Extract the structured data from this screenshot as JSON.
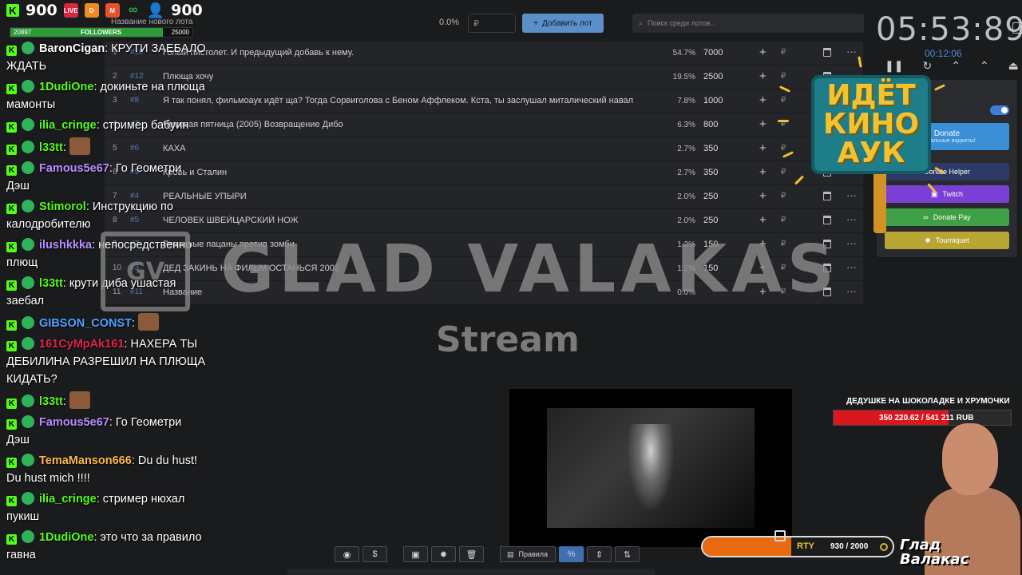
{
  "stats": {
    "kick_count": "900",
    "viewer_count": "900",
    "followers_label": "FOLLOWERS",
    "followers_current": "20897",
    "followers_goal": "25000",
    "followers_fraction": 0.836,
    "badges": [
      {
        "name": "live-badge-icon",
        "label": "LIVE",
        "color": "#d7263d"
      },
      {
        "name": "donationalerts-icon",
        "label": "D",
        "color": "#f08a24"
      },
      {
        "name": "m-badge-icon",
        "label": "M",
        "color": "#e8512c"
      },
      {
        "name": "infinity-icon",
        "label": "∞",
        "color": "#2fa84f"
      }
    ]
  },
  "auction": {
    "new_lot_placeholder": "Название нового лота",
    "total_percent": "0.0%",
    "amount_placeholder": "₽",
    "add_lot_label": "Добавить лот",
    "search_placeholder": "Поиск среди лотов...",
    "currency": "₽",
    "rows": [
      {
        "rank": "1",
        "num": "#10",
        "title": "Голый пистолет. И предыдущий добавь к нему.",
        "pct": "54.7%",
        "amount": "7000"
      },
      {
        "rank": "2",
        "num": "#12",
        "title": "Плющa хочу",
        "pct": "19.5%",
        "amount": "2500"
      },
      {
        "rank": "3",
        "num": "#8",
        "title": "Я так понял, фильмоаук идёт ща? Тогда Сорвиголова с Беном Аффлеком. Кста, ты заслушал миталический навал",
        "pct": "7.8%",
        "amount": "1000"
      },
      {
        "rank": "4",
        "num": "#2",
        "title": "Чумовая пятница (2005) Возвращение Дибо",
        "pct": "6.3%",
        "amount": "800"
      },
      {
        "rank": "5",
        "num": "#6",
        "title": "КАХА",
        "pct": "2.7%",
        "amount": "350"
      },
      {
        "rank": "6",
        "num": "#9",
        "title": "Кровь и Сталин",
        "pct": "2.7%",
        "amount": "350"
      },
      {
        "rank": "7",
        "num": "#4",
        "title": "РЕАЛЬНЫЕ УПЫРИ",
        "pct": "2.0%",
        "amount": "250"
      },
      {
        "rank": "8",
        "num": "#5",
        "title": "ЧЕЛОВЕК ШВЕЙЦАРСКИЙ НОЖ",
        "pct": "2.0%",
        "amount": "250"
      },
      {
        "rank": "9",
        "num": "#7",
        "title": "Реальные пацаны против зомби",
        "pct": "1.2%",
        "amount": "150"
      },
      {
        "rank": "10",
        "num": "#3",
        "title": "ДЕД ЗАКИНЬ НА ФИЛЬМ ОСТАНЬСЯ 2005",
        "pct": "1.2%",
        "amount": "150"
      },
      {
        "rank": "11",
        "num": "#11",
        "title": "Название",
        "pct": "0.0%",
        "amount": ""
      }
    ]
  },
  "chat": [
    {
      "user": "BaronCigan",
      "color": "#ffffff",
      "text": "КРУТИ ЗАЕБАЛО ЖДАТЬ"
    },
    {
      "user": "1DudiOne",
      "color": "#53fc18",
      "text": "докиньте на плющa мамонты"
    },
    {
      "user": "ilia_cringe",
      "color": "#53fc18",
      "text": "стример бабуин"
    },
    {
      "user": "l33tt",
      "color": "#53fc18",
      "text": ""
    },
    {
      "user": "Famous5e67",
      "color": "#b98cff",
      "text": "Го Геометри Дэш"
    },
    {
      "user": "Stimorol",
      "color": "#53fc18",
      "text": "Инструкцию по калодробителю"
    },
    {
      "user": "ilushkkka",
      "color": "#b98cff",
      "text": "непосредственно плющ"
    },
    {
      "user": "l33tt",
      "color": "#53fc18",
      "text": "крути диба ушастая заебал"
    },
    {
      "user": "GIBSON_CONST",
      "color": "#4da3ff",
      "text": ""
    },
    {
      "user": "161CyMpAk161",
      "color": "#e0234a",
      "text": "НАХЕРА ТЫ ДЕБИЛИНА РАЗРЕШИЛ НА ПЛЮЩА КИДАТЬ?"
    },
    {
      "user": "l33tt",
      "color": "#53fc18",
      "text": ""
    },
    {
      "user": "Famous5e67",
      "color": "#b98cff",
      "text": "Го Геометри Дэш"
    },
    {
      "user": "TemaManson666",
      "color": "#ffb84d",
      "text": "Du du hust! Du hust mich !!!!"
    },
    {
      "user": "ilia_cringe",
      "color": "#53fc18",
      "text": "стример нюхал пукиш"
    },
    {
      "user": "1DudiOne",
      "color": "#53fc18",
      "text": "это что за правило гавна"
    }
  ],
  "watermark": {
    "logo": "GV",
    "title": "GLAD VALAKAS",
    "subtitle": "Stream"
  },
  "timer": {
    "main": "05:53:89",
    "sub": "00:12:06"
  },
  "right_panel": {
    "buttons": [
      {
        "label": "Donate",
        "sub": "Уникальные виджеты!",
        "color": "#3a8fd6"
      },
      {
        "label": "Donate Helper",
        "color": "#2e3a66"
      },
      {
        "label": "Twitch",
        "color": "#7b3fd6"
      },
      {
        "label": "Donate Pay",
        "color": "#3fa045"
      },
      {
        "label": "Tourniquet",
        "color": "#b8a532"
      }
    ]
  },
  "sign": {
    "line1": "ИДЁТ",
    "line2": "КИНО",
    "line3": "АУК"
  },
  "goal": {
    "title": "ДЕДУШКЕ НА ШОКОЛАДКЕ И ХРУМОЧКИ",
    "progress": "350 220.62 / 541 211 RUB",
    "fraction": 0.647
  },
  "streamer": {
    "name_line1": "Глад",
    "name_line2": "Валакас"
  },
  "counter": {
    "label": "RTY",
    "value": "930 / 2000",
    "fraction": 0.465
  },
  "toolbar": {
    "rules_label": "Правила",
    "percent": "%",
    "dollar": "$"
  }
}
